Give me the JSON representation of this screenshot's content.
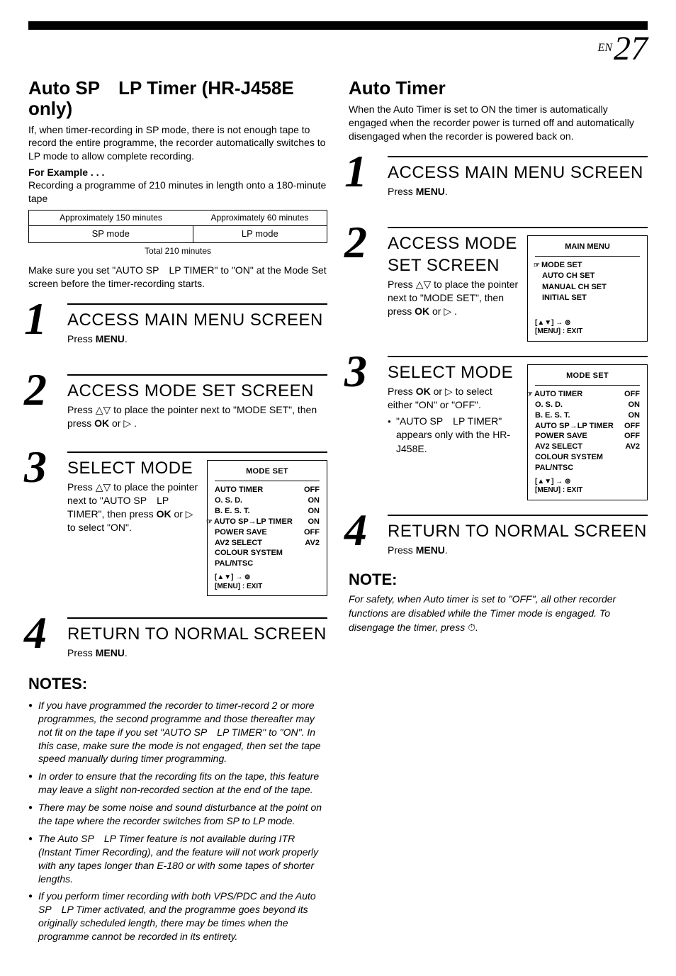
{
  "page_number_prefix": "EN",
  "page_number": "27",
  "left": {
    "title": "Auto SP LP Timer (HR-J458E only)",
    "intro": "If, when timer-recording in SP mode, there is not enough tape to record the entire programme, the recorder automatically switches to LP mode to allow complete recording.",
    "example_label": "For Example . . .",
    "example_sub": "Recording a programme of 210 minutes in length onto a 180-minute tape",
    "approx_sp": "Approximately 150 minutes",
    "approx_lp": "Approximately 60 minutes",
    "mode_sp": "SP mode",
    "mode_lp": "LP mode",
    "total": "Total 210 minutes",
    "set_note": "Make sure you set \"AUTO SP LP TIMER\" to \"ON\" at the Mode Set screen before the timer-recording starts.",
    "step1_title": "ACCESS MAIN MENU SCREEN",
    "step1_desc_a": "Press ",
    "step1_desc_b": "MENU",
    "step1_desc_c": ".",
    "step2_title": "ACCESS MODE SET SCREEN",
    "step2_desc_a": "Press ",
    "step2_desc_b": " to place the pointer next to \"MODE SET\", then press ",
    "step2_ok": "OK",
    "step2_desc_c": " or ",
    "step2_desc_d": " .",
    "step3_title": "SELECT MODE",
    "step3_desc_a": "Press ",
    "step3_desc_b": " to place the pointer next to \"AUTO SP LP TIMER\", then press ",
    "step3_ok": "OK",
    "step3_desc_c": " or ",
    "step3_desc_d": " to select \"ON\".",
    "step4_title": "RETURN TO NORMAL SCREEN",
    "step4_desc_a": "Press ",
    "step4_desc_b": "MENU",
    "step4_desc_c": ".",
    "notes_heading": "NOTES:",
    "notes": [
      "If you have programmed the recorder to timer-record 2 or more programmes, the second programme and those thereafter may not fit on the tape if you set \"AUTO SP LP TIMER\" to \"ON\". In this case, make sure the mode is not engaged, then set the tape speed manually during timer programming.",
      "In order to ensure that the recording fits on the tape, this feature may leave a slight non-recorded section at the end of the tape.",
      "There may be some noise and sound disturbance at the point on the tape where the recorder switches from SP to LP mode.",
      "The Auto SP LP Timer feature is not available during ITR (Instant Timer Recording), and the feature will not work properly with any tapes longer than E-180 or with some tapes of shorter lengths.",
      "If you perform timer recording with both VPS/PDC and the Auto SP LP Timer activated, and the programme goes beyond its originally scheduled length, there may be times when the programme cannot be recorded in its entirety."
    ]
  },
  "right": {
    "title": "Auto Timer",
    "intro": "When the Auto Timer is set to ON the timer is automatically engaged when the recorder power is turned off and automatically disengaged when the recorder is powered back on.",
    "step1_title": "ACCESS MAIN MENU SCREEN",
    "step1_desc_a": "Press ",
    "step1_desc_b": "MENU",
    "step1_desc_c": ".",
    "step2_title": "ACCESS MODE SET SCREEN",
    "step2_desc_a": "Press ",
    "step2_desc_b": " to place the pointer next to \"MODE SET\", then press ",
    "step2_ok": "OK",
    "step2_desc_c": " or ",
    "step2_desc_d": " .",
    "step3_title": "SELECT MODE",
    "step3_desc_a": "Press ",
    "step3_ok": "OK",
    "step3_desc_b": " or ",
    "step3_desc_c": " to select either \"ON\" or \"OFF\".",
    "step3_bullet": "\"AUTO SP LP TIMER\" appears only with the HR-J458E.",
    "step4_title": "RETURN TO NORMAL SCREEN",
    "step4_desc_a": "Press ",
    "step4_desc_b": "MENU",
    "step4_desc_c": ".",
    "note_title": "NOTE:",
    "note_text_a": "For safety, when Auto timer is set to \"OFF\", all other recorder functions are disabled while the Timer mode is engaged. To disengage the timer, press ",
    "note_text_b": "."
  },
  "main_menu_box": {
    "title": "MAIN MENU",
    "items": [
      "MODE SET",
      "AUTO CH SET",
      "MANUAL CH SET",
      "INITIAL SET"
    ],
    "footer_nav": "[▲▼] → ",
    "footer_exit": "[MENU] : EXIT"
  },
  "mode_set_box": {
    "title": "MODE SET",
    "rows": [
      {
        "label": "AUTO TIMER",
        "value": "OFF"
      },
      {
        "label": "O. S. D.",
        "value": "ON"
      },
      {
        "label": "B. E. S. T.",
        "value": "ON"
      },
      {
        "label": "AUTO SP→LP TIMER",
        "value": "ON",
        "pointer": true
      },
      {
        "label": "POWER SAVE",
        "value": "OFF"
      },
      {
        "label": "AV2 SELECT",
        "value": "AV2"
      },
      {
        "label": "COLOUR SYSTEM PAL/NTSC",
        "value": ""
      }
    ],
    "footer_nav": "[▲▼] → ",
    "footer_exit": "[MENU] : EXIT"
  },
  "mode_set_box_right": {
    "title": "MODE SET",
    "rows": [
      {
        "label": "AUTO TIMER",
        "value": "OFF",
        "pointer": true
      },
      {
        "label": "O. S. D.",
        "value": "ON"
      },
      {
        "label": "B. E. S. T.",
        "value": "ON"
      },
      {
        "label": "AUTO SP→LP TIMER",
        "value": "OFF"
      },
      {
        "label": "POWER SAVE",
        "value": "OFF"
      },
      {
        "label": "AV2 SELECT",
        "value": "AV2"
      },
      {
        "label": "COLOUR SYSTEM PAL/NTSC",
        "value": ""
      }
    ],
    "footer_nav": "[▲▼] → ",
    "footer_exit": "[MENU] : EXIT"
  }
}
